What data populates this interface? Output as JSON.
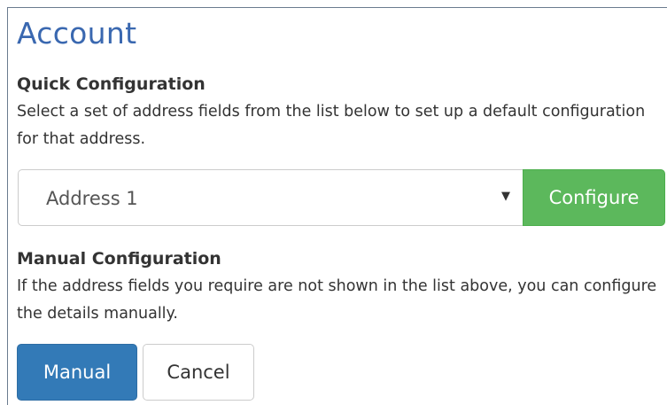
{
  "page": {
    "title": "Account"
  },
  "quick_configuration": {
    "heading": "Quick Configuration",
    "description": "Select a set of address fields from the list below to set up a default configuration for that address.",
    "select": {
      "selected_value": "Address 1",
      "caret_icon": "caret-down-icon"
    },
    "configure_label": "Configure"
  },
  "manual_configuration": {
    "heading": "Manual Configuration",
    "description": "If the address fields you require are not shown in the list above, you can configure the details manually.",
    "manual_label": "Manual",
    "cancel_label": "Cancel"
  },
  "colors": {
    "title": "#3a68b0",
    "configure_button": "#5cb85c",
    "manual_button": "#337ab7",
    "text": "#333333",
    "border": "#cccccc"
  }
}
